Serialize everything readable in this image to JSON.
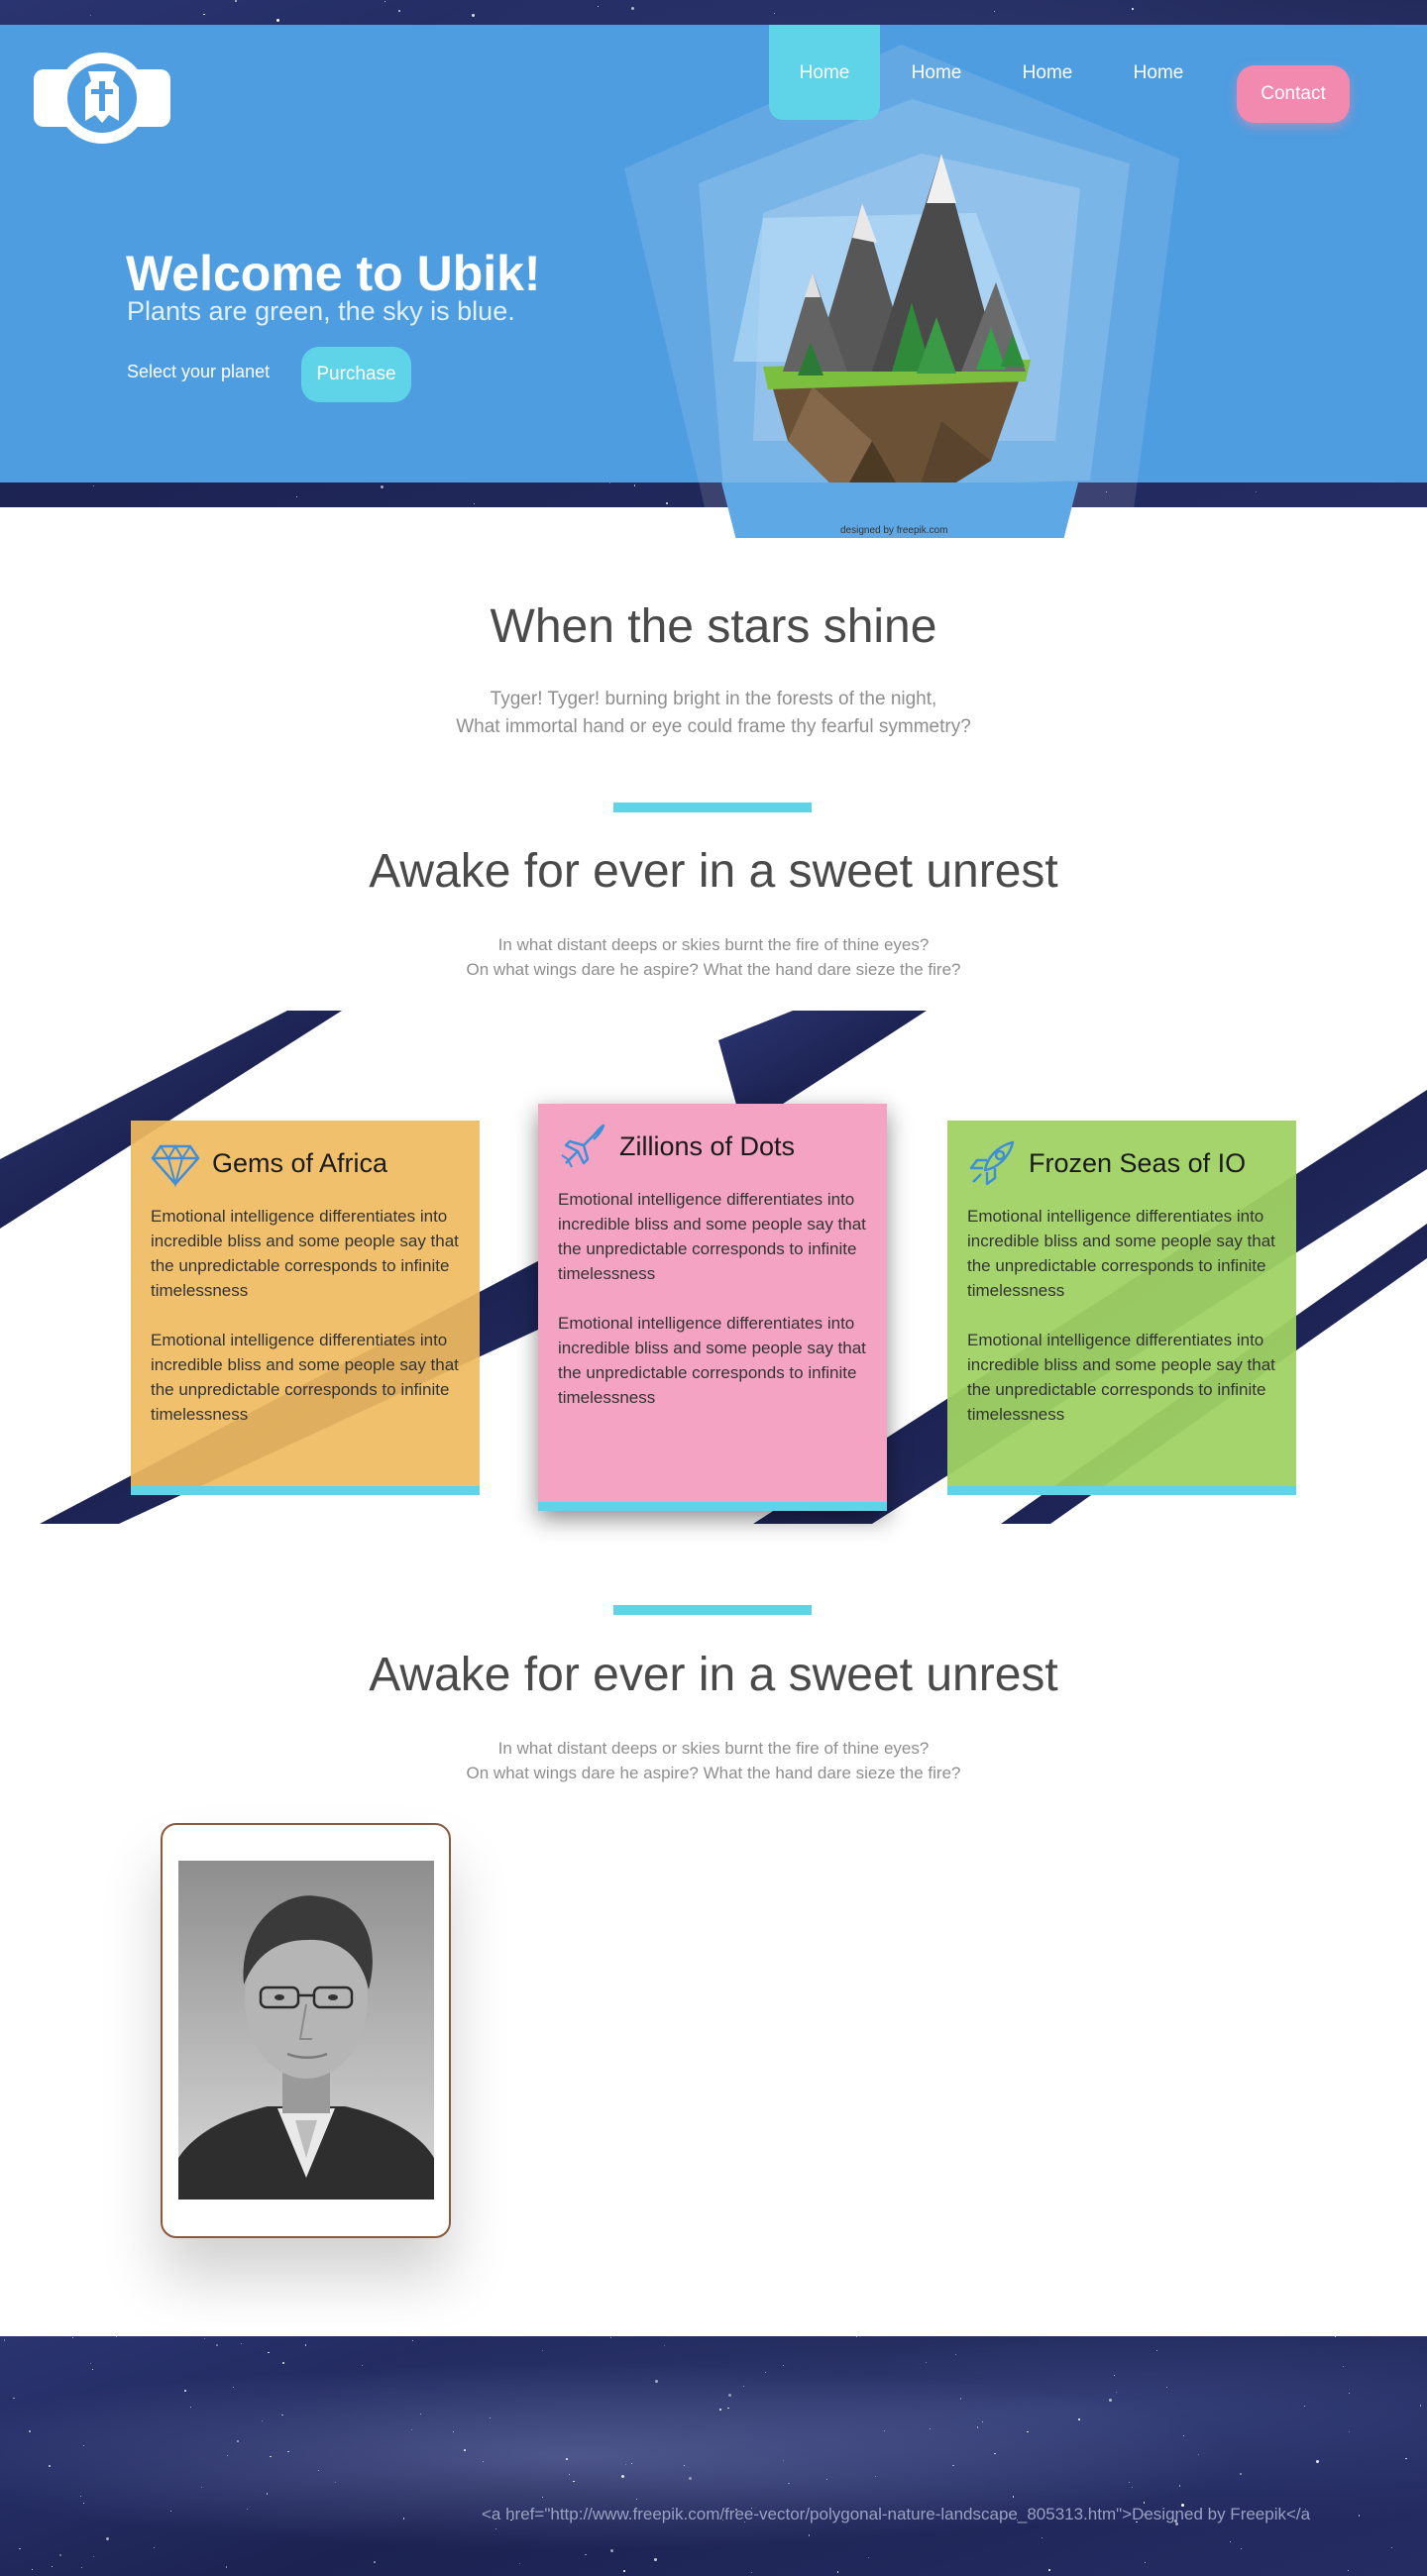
{
  "header": {
    "brand_logo": "ubik-logo",
    "nav": [
      {
        "label": "Home",
        "active": true
      },
      {
        "label": "Home",
        "active": false
      },
      {
        "label": "Home",
        "active": false
      },
      {
        "label": "Home",
        "active": false
      }
    ],
    "contact_label": "Contact"
  },
  "hero": {
    "title": "Welcome to Ubik!",
    "subtitle": "Plants are green, the sky is blue.",
    "select_label": "Select your planet",
    "purchase_label": "Purchase",
    "image_credit": "designed by   freepik.com"
  },
  "section1": {
    "title": "When the stars shine",
    "lines": [
      "Tyger! Tyger! burning bright in the forests of the night,",
      "What immortal hand or eye could frame thy fearful symmetry?"
    ]
  },
  "section2": {
    "title": "Awake for ever in a sweet unrest",
    "lines": [
      "In what distant deeps or skies burnt the fire of thine eyes?",
      "On what wings dare he aspire? What the hand dare sieze the fire?"
    ]
  },
  "cards": [
    {
      "icon": "diamond-icon",
      "title": "Gems of Africa",
      "paragraphs": [
        "Emotional intelligence differentiates into incredible bliss and some people say that the unpredictable corresponds to infinite timelessness",
        "Emotional intelligence differentiates into incredible bliss and some people say that the unpredictable corresponds to infinite timelessness"
      ]
    },
    {
      "icon": "airplane-icon",
      "title": "Zillions of Dots",
      "paragraphs": [
        "Emotional intelligence differentiates into incredible bliss and some people say that the unpredictable corresponds to infinite timelessness",
        "Emotional intelligence differentiates into incredible bliss and some people say that the unpredictable corresponds to infinite timelessness"
      ]
    },
    {
      "icon": "rocket-icon",
      "title": "Frozen Seas of IO",
      "paragraphs": [
        "Emotional intelligence differentiates into incredible bliss and some people say that the unpredictable corresponds to infinite timelessness",
        "Emotional intelligence differentiates into incredible bliss and some people say that the unpredictable corresponds to infinite timelessness"
      ]
    }
  ],
  "section3": {
    "title": "Awake for ever in a sweet unrest",
    "lines": [
      "In what distant deeps or skies burnt the fire of thine eyes?",
      "On what wings dare he aspire? What the hand dare sieze the fire?"
    ]
  },
  "footer": {
    "credit_text": "<a href=\"http://www.freepik.com/free-vector/polygonal-nature-landscape_805313.htm\">Designed by Freepik</a"
  },
  "colors": {
    "hero_blue": "#4e9de0",
    "accent_cyan": "#5fd3e8",
    "contact_pink": "#f18aae",
    "card_orange": "#f0bb5f",
    "card_pink": "#f4a3c3",
    "card_green": "#a0d264"
  }
}
